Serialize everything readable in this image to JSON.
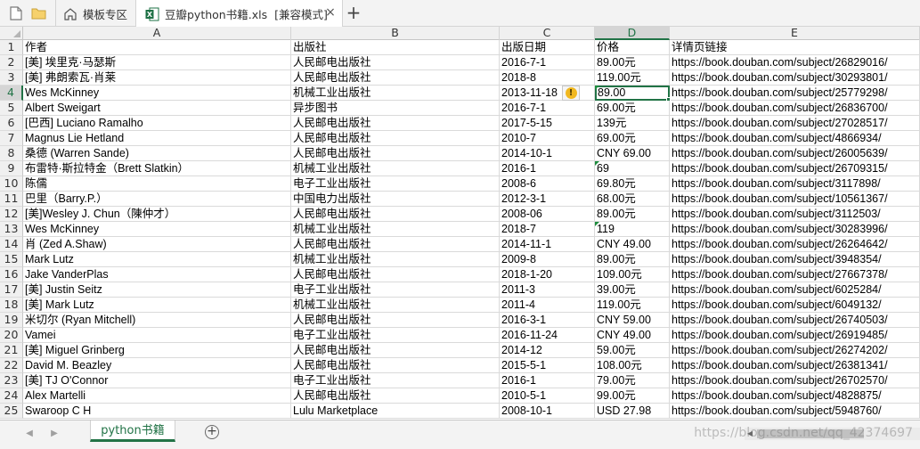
{
  "tabs": {
    "templates_label": "模板专区",
    "file_label": "豆瓣python书籍.xls",
    "mode_label": "[兼容模式]",
    "close_glyph": "×",
    "new_tab_glyph": "+"
  },
  "columns": [
    "A",
    "B",
    "C",
    "D",
    "E"
  ],
  "selected_column": "D",
  "selected_row": 4,
  "rows": [
    {
      "num": "1",
      "a": "作者",
      "b": "出版社",
      "c": "出版日期",
      "d": "价格",
      "e": "详情页链接"
    },
    {
      "num": "2",
      "a": "[美] 埃里克·马瑟斯",
      "b": "人民邮电出版社",
      "c": "2016-7-1",
      "d": "89.00元",
      "e": "https://book.douban.com/subject/26829016/"
    },
    {
      "num": "3",
      "a": "[美] 弗朗索瓦·肖莱",
      "b": "人民邮电出版社",
      "c": "2018-8",
      "d": "119.00元",
      "e": "https://book.douban.com/subject/30293801/"
    },
    {
      "num": "4",
      "a": "Wes McKinney",
      "b": "机械工业出版社",
      "c": "2013-11-18",
      "d": "89.00",
      "e": "https://book.douban.com/subject/25779298/"
    },
    {
      "num": "5",
      "a": "Albert Sweigart",
      "b": "异步图书",
      "c": "2016-7-1",
      "d": "69.00元",
      "e": "https://book.douban.com/subject/26836700/"
    },
    {
      "num": "6",
      "a": "[巴西] Luciano Ramalho",
      "b": "人民邮电出版社",
      "c": "2017-5-15",
      "d": "139元",
      "e": "https://book.douban.com/subject/27028517/"
    },
    {
      "num": "7",
      "a": "Magnus Lie Hetland",
      "b": "人民邮电出版社",
      "c": "2010-7",
      "d": "69.00元",
      "e": "https://book.douban.com/subject/4866934/"
    },
    {
      "num": "8",
      "a": "桑德 (Warren Sande)",
      "b": "人民邮电出版社",
      "c": "2014-10-1",
      "d": "CNY 69.00",
      "e": "https://book.douban.com/subject/26005639/"
    },
    {
      "num": "9",
      "a": "布雷特·斯拉特金（Brett Slatkin）",
      "b": "机械工业出版社",
      "c": "2016-1",
      "d": "69",
      "e": "https://book.douban.com/subject/26709315/"
    },
    {
      "num": "10",
      "a": "陈儒",
      "b": "电子工业出版社",
      "c": "2008-6",
      "d": "69.80元",
      "e": "https://book.douban.com/subject/3117898/"
    },
    {
      "num": "11",
      "a": "巴里（Barry.P.）",
      "b": "中国电力出版社",
      "c": "2012-3-1",
      "d": "68.00元",
      "e": "https://book.douban.com/subject/10561367/"
    },
    {
      "num": "12",
      "a": "[美]Wesley J. Chun（陳仲才）",
      "b": "人民邮电出版社",
      "c": "2008-06",
      "d": "89.00元",
      "e": "https://book.douban.com/subject/3112503/"
    },
    {
      "num": "13",
      "a": "Wes McKinney",
      "b": "机械工业出版社",
      "c": "2018-7",
      "d": "119",
      "e": "https://book.douban.com/subject/30283996/"
    },
    {
      "num": "14",
      "a": "肖 (Zed A.Shaw)",
      "b": "人民邮电出版社",
      "c": "2014-11-1",
      "d": "CNY 49.00",
      "e": "https://book.douban.com/subject/26264642/"
    },
    {
      "num": "15",
      "a": "Mark Lutz",
      "b": "机械工业出版社",
      "c": "2009-8",
      "d": "89.00元",
      "e": "https://book.douban.com/subject/3948354/"
    },
    {
      "num": "16",
      "a": "Jake VanderPlas",
      "b": "人民邮电出版社",
      "c": "2018-1-20",
      "d": "109.00元",
      "e": "https://book.douban.com/subject/27667378/"
    },
    {
      "num": "17",
      "a": "[美] Justin Seitz",
      "b": "电子工业出版社",
      "c": "2011-3",
      "d": "39.00元",
      "e": "https://book.douban.com/subject/6025284/"
    },
    {
      "num": "18",
      "a": "[美] Mark Lutz",
      "b": "机械工业出版社",
      "c": "2011-4",
      "d": "119.00元",
      "e": "https://book.douban.com/subject/6049132/"
    },
    {
      "num": "19",
      "a": "米切尔 (Ryan Mitchell)",
      "b": "人民邮电出版社",
      "c": "2016-3-1",
      "d": "CNY 59.00",
      "e": "https://book.douban.com/subject/26740503/"
    },
    {
      "num": "20",
      "a": "Vamei",
      "b": "电子工业出版社",
      "c": "2016-11-24",
      "d": "CNY 49.00",
      "e": "https://book.douban.com/subject/26919485/"
    },
    {
      "num": "21",
      "a": "[美] Miguel Grinberg",
      "b": "人民邮电出版社",
      "c": "2014-12",
      "d": "59.00元",
      "e": "https://book.douban.com/subject/26274202/"
    },
    {
      "num": "22",
      "a": "David M. Beazley",
      "b": "人民邮电出版社",
      "c": "2015-5-1",
      "d": "108.00元",
      "e": "https://book.douban.com/subject/26381341/"
    },
    {
      "num": "23",
      "a": "[美] TJ O'Connor",
      "b": "电子工业出版社",
      "c": "2016-1",
      "d": "79.00元",
      "e": "https://book.douban.com/subject/26702570/"
    },
    {
      "num": "24",
      "a": "Alex Martelli",
      "b": "人民邮电出版社",
      "c": "2010-5-1",
      "d": "99.00元",
      "e": "https://book.douban.com/subject/4828875/"
    },
    {
      "num": "25",
      "a": "Swaroop C H",
      "b": "Lulu Marketplace",
      "c": "2008-10-1",
      "d": "USD 27.98",
      "e": "https://book.douban.com/subject/5948760/"
    }
  ],
  "number_stored_as_text_rows": [
    4,
    9,
    13
  ],
  "sheet": {
    "tab_label": "python书籍",
    "add_glyph": "+",
    "prev_glyph": "◀",
    "next_glyph": "▶"
  },
  "watermark": "https://blog.csdn.net/qq_42374697",
  "colors": {
    "accent": "#217346",
    "warning": "#f1b820",
    "excel_icon": "#1e7145"
  },
  "icons": {
    "blank_doc": "blank-doc-icon",
    "folder": "folder-icon",
    "home": "home-icon",
    "excel": "excel-file-icon",
    "warning": "warning-icon"
  }
}
